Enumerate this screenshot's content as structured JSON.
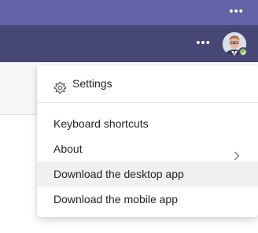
{
  "header": {
    "window_overflow_icon": "more-horizontal-icon",
    "app_overflow_icon": "more-horizontal-icon",
    "avatar_status": "available"
  },
  "menu": {
    "settings_label": "Settings",
    "items": [
      {
        "label": "Keyboard shortcuts"
      },
      {
        "label": "About",
        "has_submenu": true
      },
      {
        "label": "Download the desktop app",
        "highlighted": true
      },
      {
        "label": "Download the mobile app"
      }
    ]
  },
  "colors": {
    "titlebar": "#6264a7",
    "appbar": "#464775",
    "presence_available": "#92c353"
  }
}
